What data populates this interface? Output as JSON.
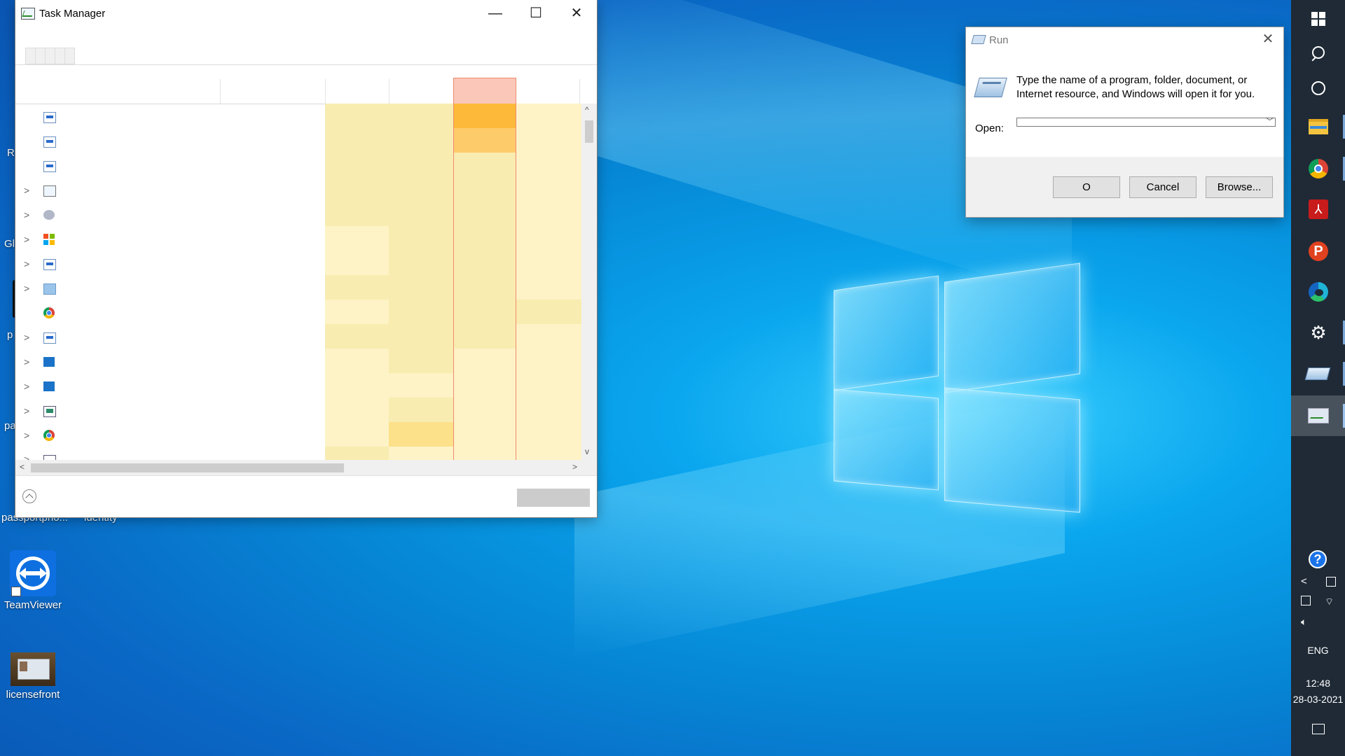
{
  "task_manager": {
    "title": "Task Manager",
    "minimize_glyph": "—",
    "maximize_glyph": "☐",
    "close_glyph": "✕"
  },
  "run_dialog": {
    "title": "Run",
    "description": "Type the name of a program, folder, document, or Internet resource, and Windows will open it for you.",
    "open_label": "Open:",
    "open_value": "",
    "ok_label": "O",
    "cancel_label": "Cancel",
    "browse_label": "Browse..."
  },
  "desktop": {
    "icons": [
      {
        "label": "TeamViewer",
        "icon": "teamviewer-icon"
      },
      {
        "label": "licensefront",
        "icon": "image-file-icon"
      }
    ],
    "partial_labels": [
      "R",
      "Gl",
      "p",
      "pa",
      "passportpho...",
      "identity"
    ]
  },
  "taskbar": {
    "items": [
      "start-icon",
      "search-icon",
      "cortana-icon",
      "file-explorer-icon",
      "chrome-icon",
      "acrobat-icon",
      "pdf-p-icon",
      "edge-icon",
      "settings-icon",
      "run-icon",
      "task-manager-icon"
    ],
    "language": "ENG",
    "time": "12:48",
    "date": "28-03-2021"
  }
}
